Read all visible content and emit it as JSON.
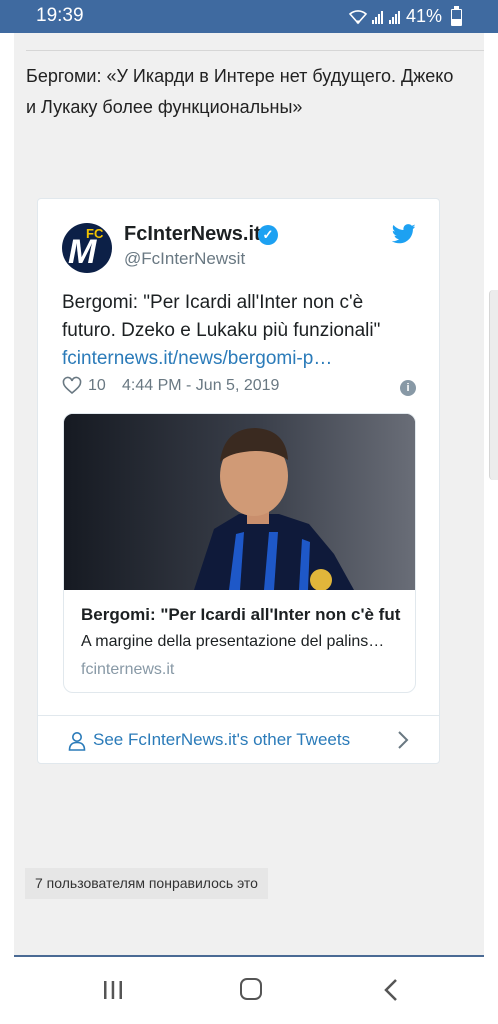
{
  "status_bar": {
    "time": "19:39",
    "battery": "41%"
  },
  "post": {
    "text": "Бергоми: «У Икарди в Интере нет будущего. Джеко и Лукаку более функциональны»"
  },
  "tweet": {
    "display_name": "FcInterNews.it",
    "handle": "@FcInterNewsit",
    "avatar_letters": "FC",
    "text": "Bergomi: \"Per Icardi all'Inter non c'è futuro. Dzeko e Lukaku più funzionali\"",
    "link": "fcinternews.it/news/bergomi-p…",
    "likes": "10",
    "timestamp": "4:44 PM - Jun 5, 2019",
    "card": {
      "title": "Bergomi: \"Per Icardi all'Inter non c'è fut…",
      "description": "A margine della presentazione del palins…",
      "domain": "fcinternews.it"
    },
    "footer_link": "See FcInterNews.it's other Tweets"
  },
  "likes_note": "7 пользователям понравилось это",
  "colors": {
    "status_bar": "#3f6aa0",
    "link": "#2b7bb9",
    "twitter_blue": "#1da1f2"
  }
}
